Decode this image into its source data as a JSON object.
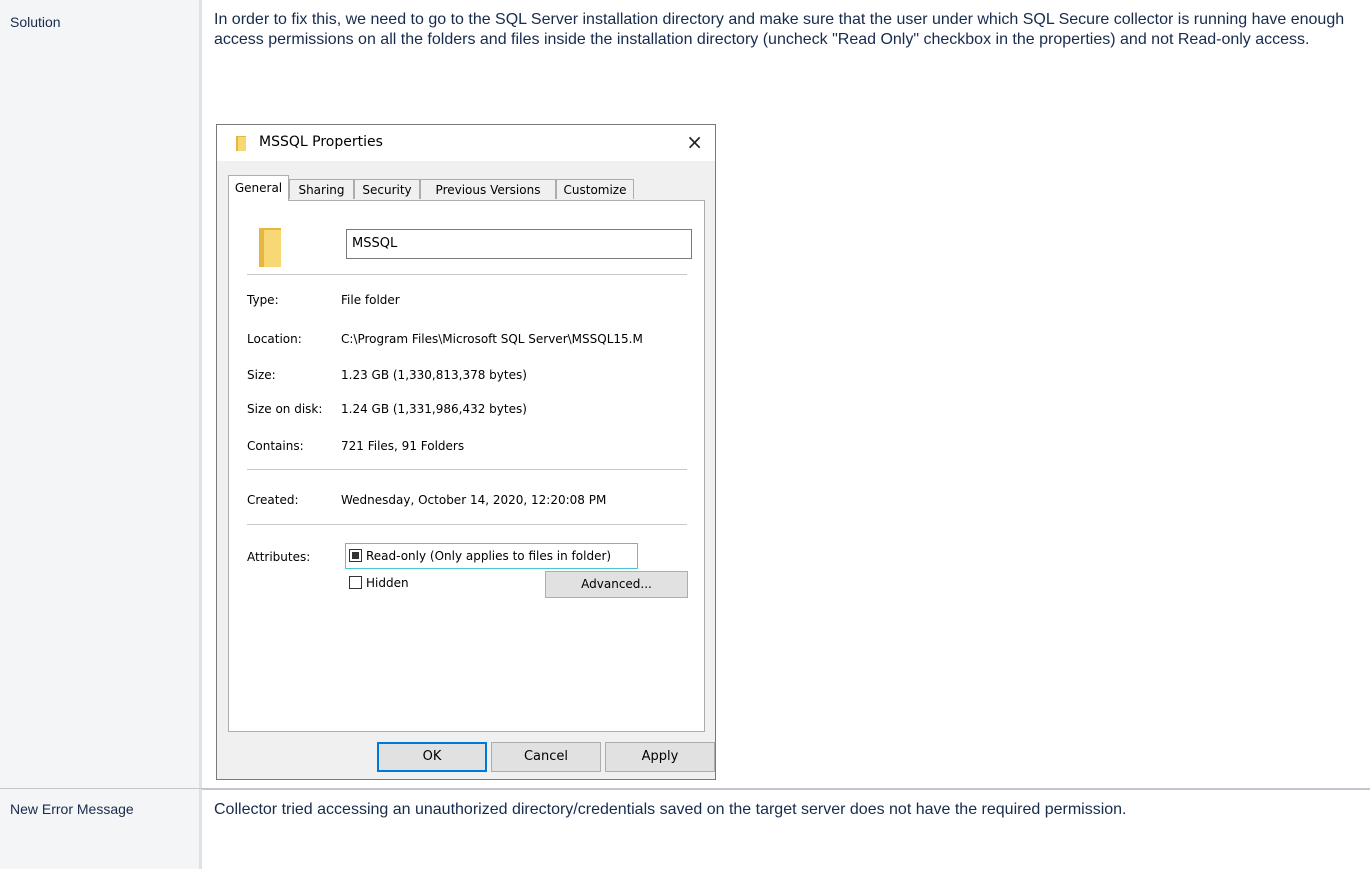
{
  "rows": [
    {
      "label": "Solution",
      "text": "In order to fix this, we need to go to the SQL Server installation directory and make sure that the user under which SQL Secure collector is running have enough access permissions on all the folders and files inside the installation directory (uncheck \"Read Only\" checkbox in the properties) and not Read-only access."
    },
    {
      "label": "New Error Message",
      "text": "Collector tried accessing an unauthorized directory/credentials saved on the target server does not have the required permission."
    }
  ],
  "dialog": {
    "title": "MSSQL Properties",
    "close_glyph": "×",
    "tabs": [
      "General",
      "Sharing",
      "Security",
      "Previous Versions",
      "Customize"
    ],
    "active_tab": "General",
    "folder_name": "MSSQL",
    "type_label": "Type:",
    "type_value": "File folder",
    "location_label": "Location:",
    "location_value": "C:\\Program Files\\Microsoft SQL Server\\MSSQL15.M",
    "size_label": "Size:",
    "size_value": "1.23 GB (1,330,813,378 bytes)",
    "size_on_disk_label": "Size on disk:",
    "size_on_disk_value": "1.24 GB (1,331,986,432 bytes)",
    "contains_label": "Contains:",
    "contains_value": "721 Files, 91 Folders",
    "created_label": "Created:",
    "created_value": "Wednesday, October 14, 2020, 12:20:08 PM",
    "attributes_label": "Attributes:",
    "readonly_label": "Read-only (Only applies to files in folder)",
    "hidden_label": "Hidden",
    "advanced_label": "Advanced...",
    "ok_label": "OK",
    "cancel_label": "Cancel",
    "apply_label": "Apply",
    "folder_color": "#f8d775"
  }
}
